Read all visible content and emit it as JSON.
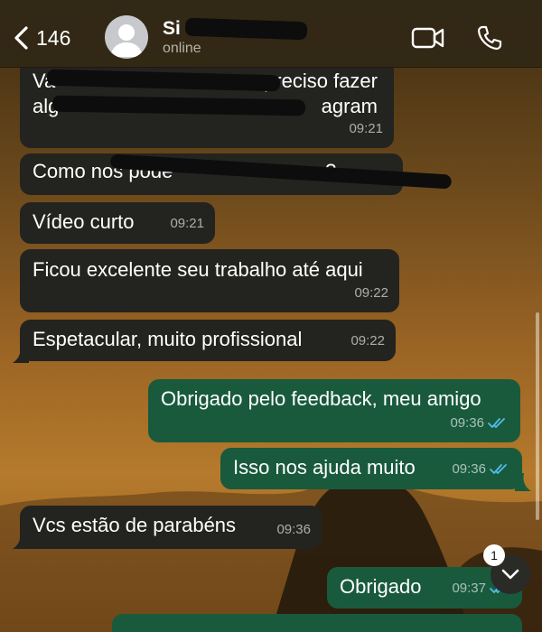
{
  "header": {
    "back_count": "146",
    "contact_name": "Si",
    "contact_status": "online",
    "icons": {
      "back": "chevron-left-icon",
      "avatar": "person-icon",
      "video": "video-camera-icon",
      "phone": "phone-icon"
    }
  },
  "messages": [
    {
      "direction": "incoming",
      "text_line1": "Va",
      "text_line1_end": "preciso fazer",
      "text_line2": "alg",
      "text_line2_end": "agram",
      "time": "09:21",
      "redacted": true
    },
    {
      "direction": "incoming",
      "text": "Como nos pode",
      "suffix": "?",
      "time": "",
      "redacted": true
    },
    {
      "direction": "incoming",
      "text": "Vídeo curto",
      "time": "09:21"
    },
    {
      "direction": "incoming",
      "text": "Ficou excelente seu trabalho até aqui",
      "time": "09:22"
    },
    {
      "direction": "incoming",
      "text": "Espetacular, muito profissional",
      "time": "09:22"
    },
    {
      "direction": "outgoing",
      "text": "Obrigado pelo feedback, meu amigo",
      "time": "09:36",
      "status": "read"
    },
    {
      "direction": "outgoing",
      "text": "Isso nos ajuda muito",
      "time": "09:36",
      "status": "read"
    },
    {
      "direction": "incoming",
      "text": "Vcs estão de parabéns",
      "time": "09:36"
    },
    {
      "direction": "outgoing",
      "text": "Obrigado",
      "time": "09:37",
      "status": "read"
    }
  ],
  "scroll_down": {
    "badge_count": "1",
    "icon": "chevron-down-icon"
  },
  "colors": {
    "incoming_bubble": "#232320",
    "outgoing_bubble": "#195a3d",
    "read_ticks": "#53bdeb",
    "header_bg": "#302816"
  }
}
